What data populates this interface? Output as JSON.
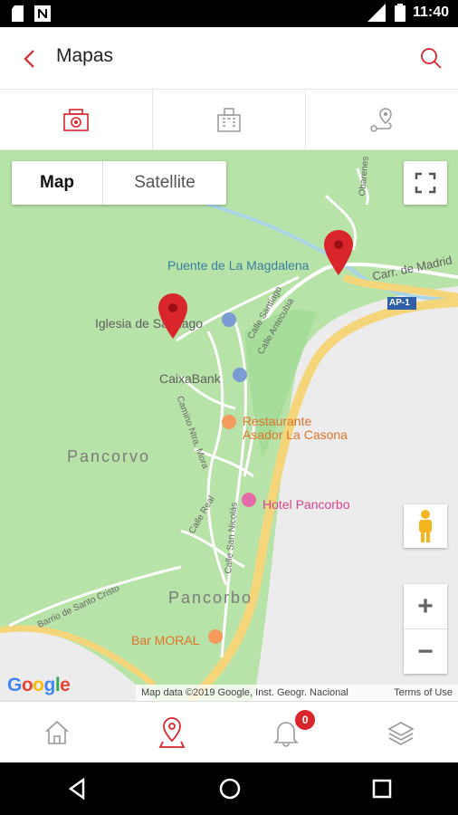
{
  "status_bar": {
    "time": "11:40"
  },
  "header": {
    "title": "Mapas"
  },
  "map": {
    "type_control": {
      "map_label": "Map",
      "satellite_label": "Satellite",
      "selected": "Map"
    },
    "labels": {
      "puente": "Puente de La Magdalena",
      "carr": "Carr. de Madrid",
      "ap1": "AP-1",
      "iglesia": "Iglesia de Santiago",
      "caixabank": "CaixaBank",
      "restaurante_1": "Restaurante",
      "restaurante_2": "Asador La Casona",
      "hotel": "Hotel Pancorbo",
      "pancorvo": "Pancorvo",
      "pancorbo": "Pancorbo",
      "bar": "Bar MORAL"
    },
    "streets": {
      "santiago": "Calle Santiago",
      "antecubia": "Calle Antecubia",
      "camino": "Camino Ntra. Mora",
      "real": "Calle Real",
      "san_nicolas": "Calle San Nicolás",
      "barrio": "Barrio de Santo Cristo",
      "obarenes": "Obarenes"
    },
    "zoom_in": "+",
    "zoom_out": "−",
    "google_logo": "Google",
    "attribution": "Map data ©2019 Google, Inst. Geogr. Nacional",
    "terms": "Terms of Use"
  },
  "bottom_nav": {
    "notifications_badge": "0"
  },
  "colors": {
    "accent": "#d9262c",
    "map_green": "#b7e3a8"
  }
}
